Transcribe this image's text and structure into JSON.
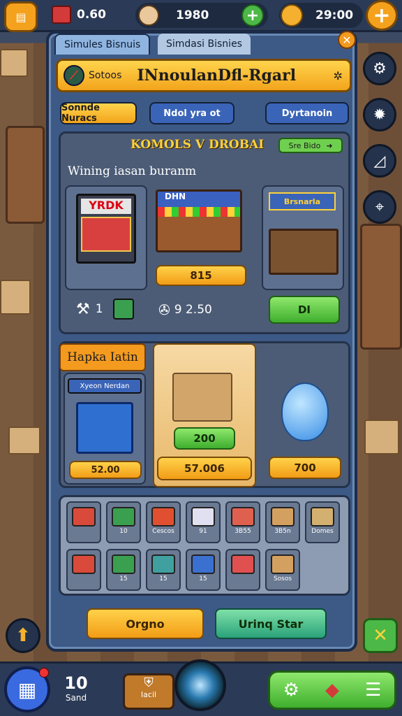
{
  "hud": {
    "coins": "0.60",
    "cash": "1980",
    "gems": "29:00"
  },
  "panel": {
    "tabs": [
      "Simules Bisnuis",
      "Simdasi Bisnies"
    ],
    "title_tag": "Sotoos",
    "title": "INnoulanDfl-Rgarl",
    "pills": [
      "Sonnde Nuracs",
      "Ndol yra ot",
      "Dyrtanoin"
    ]
  },
  "shop_section": {
    "heading": "KOMOLS V DROBAI",
    "tag": "Sre Bido",
    "subtitle": "Wining iasan buranm",
    "booth_sign": "YRDK",
    "stall_sign": "DHN",
    "shop_sign": "Brsnarla",
    "price_btn": "815",
    "stat1": "1",
    "stat2": "9  2.50",
    "buy_btn": "DI"
  },
  "mid_section": {
    "heading": "Hapka Iatin",
    "card1_label": "Xyeon Nerdan",
    "card1_price": "52.00",
    "card2_green": "200",
    "card2_price": "57.006",
    "card3_price": "700"
  },
  "inventory": {
    "row1": [
      {
        "label": "",
        "color": "#d94a3a"
      },
      {
        "label": "10",
        "color": "#3aa050"
      },
      {
        "label": "Cescos",
        "color": "#e05030"
      },
      {
        "label": "91",
        "color": "#e0e0f0"
      },
      {
        "label": "3B55",
        "color": "#e06050"
      },
      {
        "label": "3B5n",
        "color": "#d4a060"
      },
      {
        "label": "Domes",
        "color": "#d4b070"
      }
    ],
    "row2": [
      {
        "label": "",
        "color": "#d94a3a"
      },
      {
        "label": "15",
        "color": "#3aa050"
      },
      {
        "label": "15",
        "color": "#40a0a0"
      },
      {
        "label": "15",
        "color": "#3a70d0"
      },
      {
        "label": "",
        "color": "#e05050"
      },
      {
        "label": "Sosos",
        "color": "#d4a060"
      }
    ]
  },
  "footer_buttons": {
    "left": "Orgno",
    "right": "Urinq Star"
  },
  "bottom": {
    "count": "10",
    "count_label": "Sand",
    "badge_label": "Iacil"
  }
}
